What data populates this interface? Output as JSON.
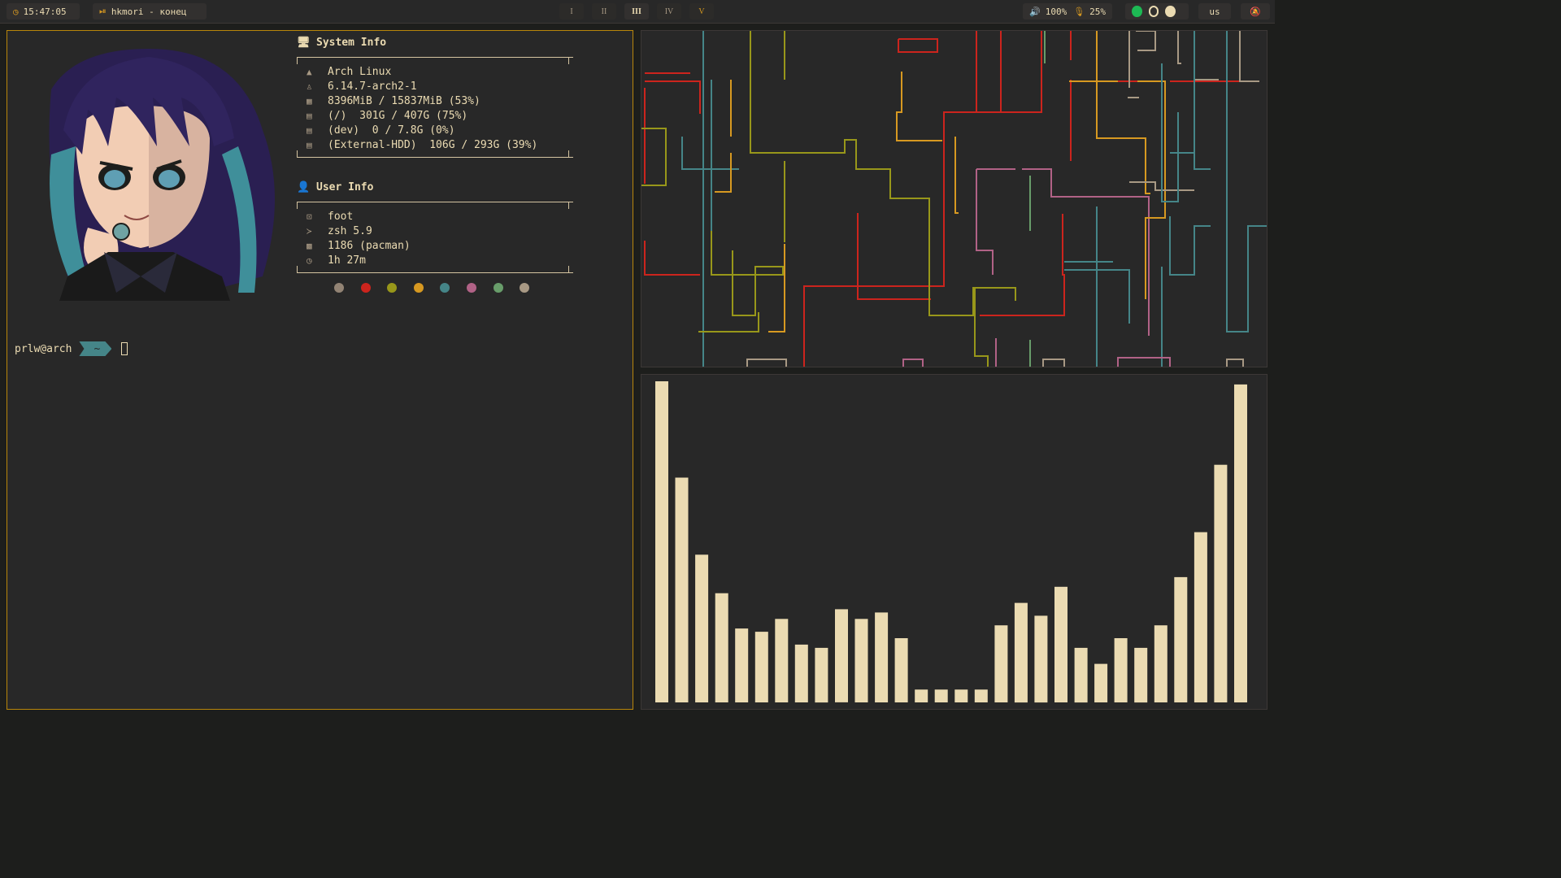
{
  "topbar": {
    "clock": "15:47:05",
    "media": "hkmori - конец",
    "workspaces": [
      "I",
      "II",
      "III",
      "IV",
      "V"
    ],
    "active_workspace": "III",
    "volume": "100%",
    "mic": "25%",
    "tray_icons": [
      "spotify-icon",
      "vesktop-icon",
      "steam-icon"
    ],
    "layout": "us",
    "notifications_icon": "bell-off-icon"
  },
  "fetch": {
    "system_title": "System Info",
    "system_rows": [
      {
        "icon": "arch-logo-icon",
        "text": "Arch Linux"
      },
      {
        "icon": "tux-icon",
        "text": "6.14.7-arch2-1"
      },
      {
        "icon": "memory-icon",
        "text": "8396MiB / 15837MiB (53%)"
      },
      {
        "icon": "disk-icon",
        "text": "(/)  301G / 407G (75%)"
      },
      {
        "icon": "disk-icon",
        "text": "(dev)  0 / 7.8G (0%)"
      },
      {
        "icon": "disk-icon",
        "text": "(External-HDD)  106G / 293G (39%)"
      }
    ],
    "user_title": "User Info",
    "user_rows": [
      {
        "icon": "terminal-icon",
        "text": "foot"
      },
      {
        "icon": "shell-icon",
        "text": "zsh 5.9"
      },
      {
        "icon": "package-icon",
        "text": "1186 (pacman)"
      },
      {
        "icon": "clock-icon",
        "text": "1h 27m"
      }
    ],
    "palette": [
      "#928374",
      "#cc241d",
      "#98971a",
      "#d79921",
      "#458588",
      "#b16286",
      "#689d6a",
      "#a89984"
    ]
  },
  "prompt": {
    "user_host": "prlw@arch",
    "dir": "~"
  },
  "visualizer": {
    "color": "#ebdbb2",
    "levels": [
      1.0,
      0.7,
      0.46,
      0.34,
      0.23,
      0.22,
      0.26,
      0.18,
      0.17,
      0.29,
      0.26,
      0.28,
      0.2,
      0.04,
      0.04,
      0.04,
      0.04,
      0.24,
      0.31,
      0.27,
      0.36,
      0.17,
      0.12,
      0.2,
      0.17,
      0.24,
      0.39,
      0.53,
      0.74,
      0.99
    ]
  }
}
